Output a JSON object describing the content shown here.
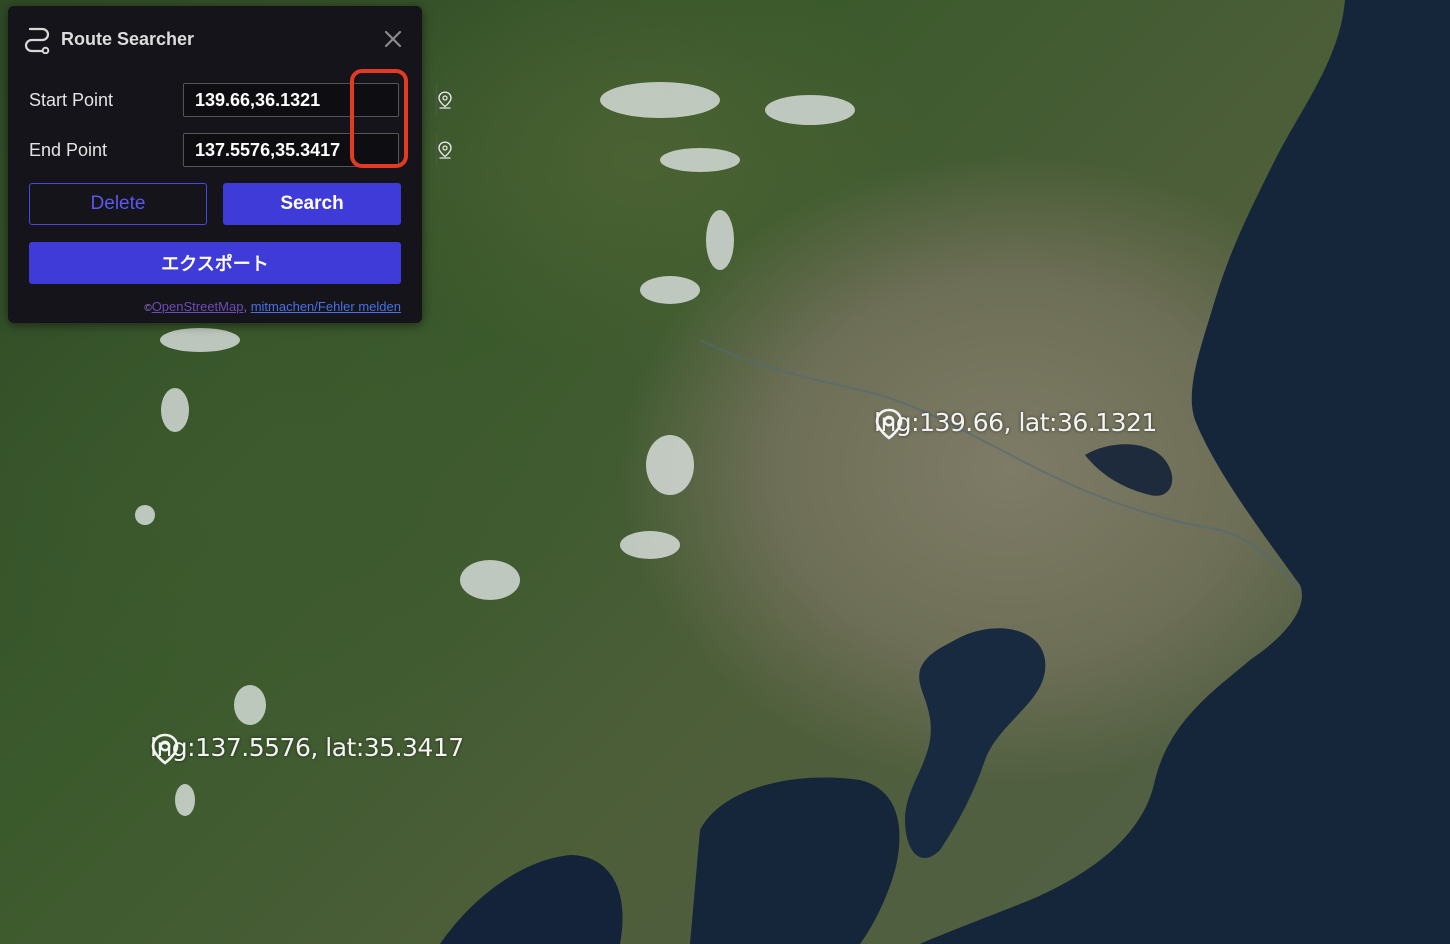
{
  "panel": {
    "title": "Route Searcher",
    "start_label": "Start Point",
    "start_value": "139.66,36.1321",
    "end_label": "End Point",
    "end_value": "137.5576,35.3417",
    "delete_label": "Delete",
    "search_label": "Search",
    "export_label": "エクスポート",
    "attribution": {
      "copyright": "©",
      "osm_link": "OpenStreetMap",
      "separator": ", ",
      "fix_link": "mitmachen/Fehler melden"
    },
    "icons": {
      "header": "route-icon",
      "close": "close-icon",
      "picker": "map-pin-icon"
    },
    "colors": {
      "primary": "#3f3bd8",
      "panel_bg": "#14141a",
      "highlight": "#e23a23"
    }
  },
  "map": {
    "markers": [
      {
        "label": "lng:139.66, lat:36.1321"
      },
      {
        "label": "lng:137.5576, lat:35.3417"
      }
    ],
    "colors": {
      "sea": "#16263a",
      "land": "#3b5a2c"
    }
  }
}
